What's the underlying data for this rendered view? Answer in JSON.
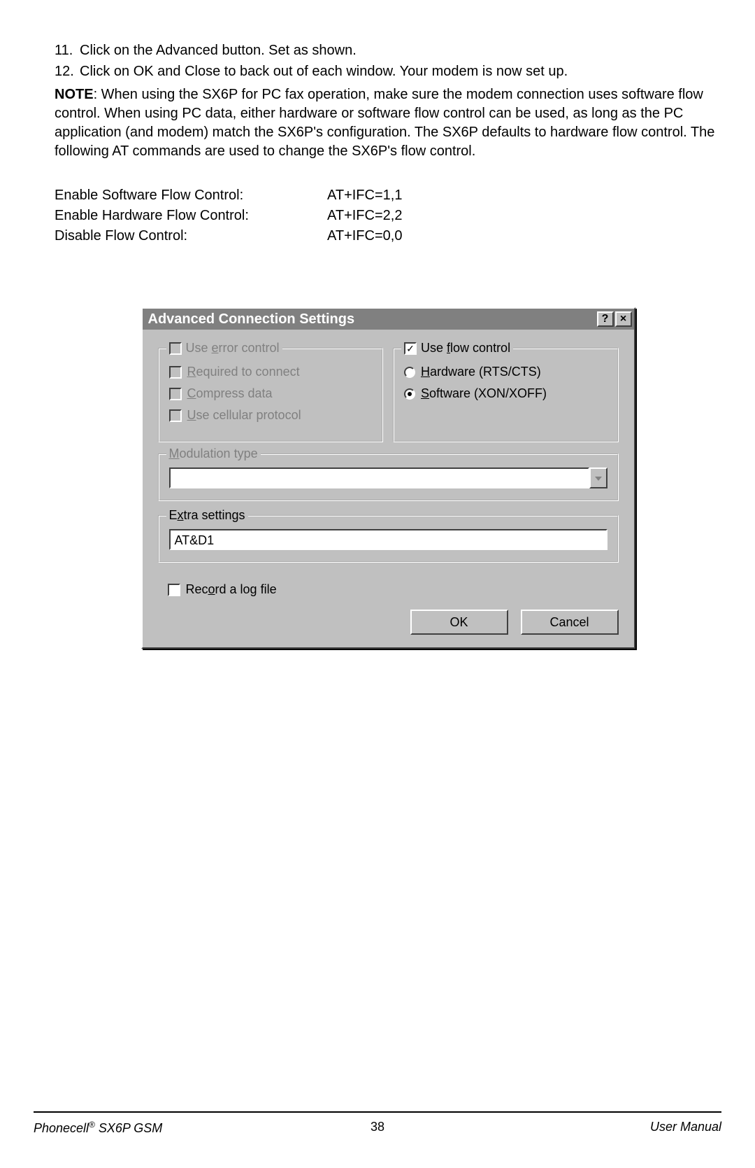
{
  "instructions": {
    "item11_num": "11.",
    "item11_text": "Click on the Advanced button. Set as shown.",
    "item12_num": "12.",
    "item12_text": "Click on OK and Close to back out of each window. Your modem is now set up."
  },
  "note": {
    "label": "NOTE",
    "text": ": When using the SX6P for PC fax operation, make sure the modem connection uses software flow control. When using PC data, either hardware or software flow control can be used, as long as the PC application (and modem) match the SX6P's configuration. The SX6P defaults to hardware flow control. The following AT commands are used to change the SX6P's flow control."
  },
  "at_commands": {
    "row1_label": "Enable Software Flow Control:",
    "row1_cmd": "AT+IFC=1,1",
    "row2_label": "Enable Hardware Flow Control:",
    "row2_cmd": "AT+IFC=2,2",
    "row3_label": "Disable Flow Control:",
    "row3_cmd": "AT+IFC=0,0"
  },
  "dialog": {
    "title": "Advanced Connection Settings",
    "help_btn": "?",
    "close_btn": "×",
    "error_control": {
      "legend_label": "Use error control",
      "required": "Required to connect",
      "compress": "Compress data",
      "cellular": "Use cellular protocol"
    },
    "flow_control": {
      "legend_label": "Use flow control",
      "checked_mark": "✓",
      "hardware": "Hardware (RTS/CTS)",
      "software": "Software (XON/XOFF)"
    },
    "modulation_legend": "Modulation type",
    "extra_legend": "Extra settings",
    "extra_value": "AT&D1",
    "log_label": "Record a log file",
    "ok_label": "OK",
    "cancel_label": "Cancel"
  },
  "footer": {
    "left_prefix": "Phonecell",
    "left_reg": "®",
    "left_suffix": " SX6P GSM",
    "page": "38",
    "right": "User Manual"
  }
}
